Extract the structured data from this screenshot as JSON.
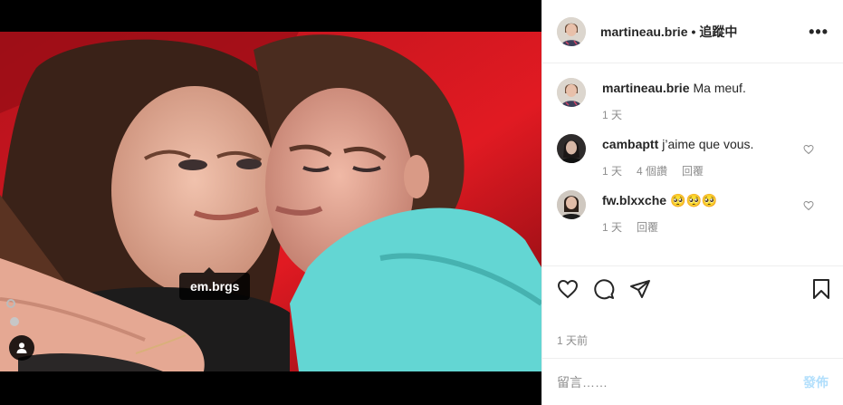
{
  "post": {
    "photo_tag": "em.brgs",
    "icons": {
      "user_tag": "person-icon"
    }
  },
  "header": {
    "username": "martineau.brie",
    "separator": "•",
    "follow_status": "追蹤中",
    "more": "•••"
  },
  "comments": [
    {
      "username": "martineau.brie",
      "text": "Ma meuf.",
      "time": "1 天",
      "likes": "",
      "reply": ""
    },
    {
      "username": "cambaptt",
      "text": "j’aime que vous.",
      "time": "1 天",
      "likes": "4 個讚",
      "reply": "回覆"
    },
    {
      "username": "fw.blxxche",
      "text": "🥺🥺🥺",
      "time": "1 天",
      "likes": "",
      "reply": "回覆"
    }
  ],
  "timestamp": "1 天前",
  "composer": {
    "placeholder": "留言……",
    "post_label": "發佈"
  },
  "colors": {
    "accent_disabled": "#b2dffc",
    "muted_text": "#8e8e8e",
    "border": "#efefef"
  }
}
